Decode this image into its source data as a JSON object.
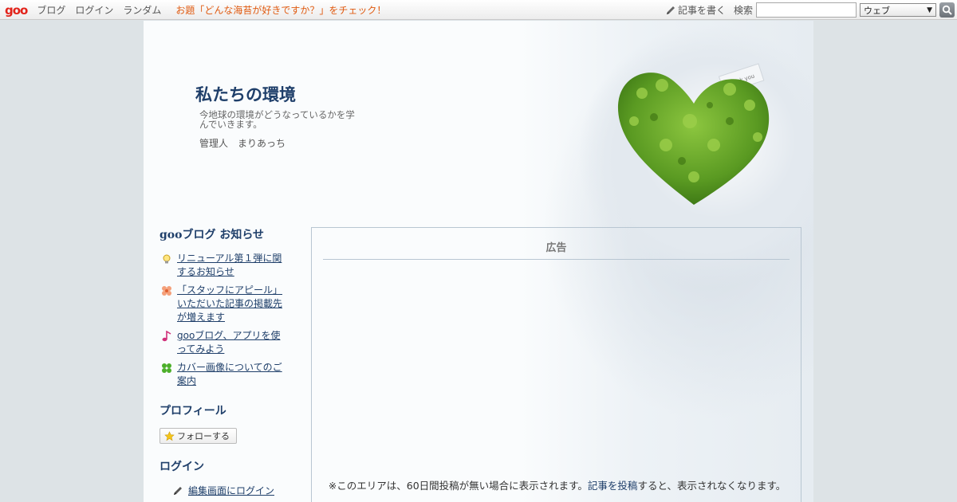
{
  "toolbar": {
    "logo": "goo",
    "links": [
      "ブログ",
      "ログイン",
      "ランダム"
    ],
    "promo": "お題「どんな海苔が好きですか？」をチェック！",
    "write_label": "記事を書く",
    "search_label": "検索",
    "search_placeholder": "",
    "search_select": "ウェブ"
  },
  "header": {
    "title": "私たちの環境",
    "description": "今地球の環境がどうなっているかを学んでいきます。",
    "admin": "管理人　まりあっち",
    "image_tag": "Thank you"
  },
  "sidebar": {
    "news_heading": "gooブログ お知らせ",
    "news": [
      {
        "icon": "lightbulb-icon",
        "label": "リニューアル第１弾に関するお知らせ"
      },
      {
        "icon": "flower-icon",
        "label": "「スタッフにアピール」いただいた記事の掲載先が増えます"
      },
      {
        "icon": "music-note-icon",
        "label": "gooブログ、アプリを使ってみよう"
      },
      {
        "icon": "clover-icon",
        "label": "カバー画像についてのご案内"
      }
    ],
    "profile_heading": "プロフィール",
    "follow_label": "フォローする",
    "login_heading": "ログイン",
    "login_link": "編集画面にログイン"
  },
  "ad": {
    "title": "広告",
    "note_prefix": "※このエリアは、60日間投稿が無い場合に表示されます。",
    "note_link": "記事を投稿",
    "note_suffix": "すると、表示されなくなります。"
  },
  "colors": {
    "accent": "#1f3f6a",
    "promo": "#e05a10",
    "logo": "#e2231a",
    "background": "#dde3e6"
  }
}
